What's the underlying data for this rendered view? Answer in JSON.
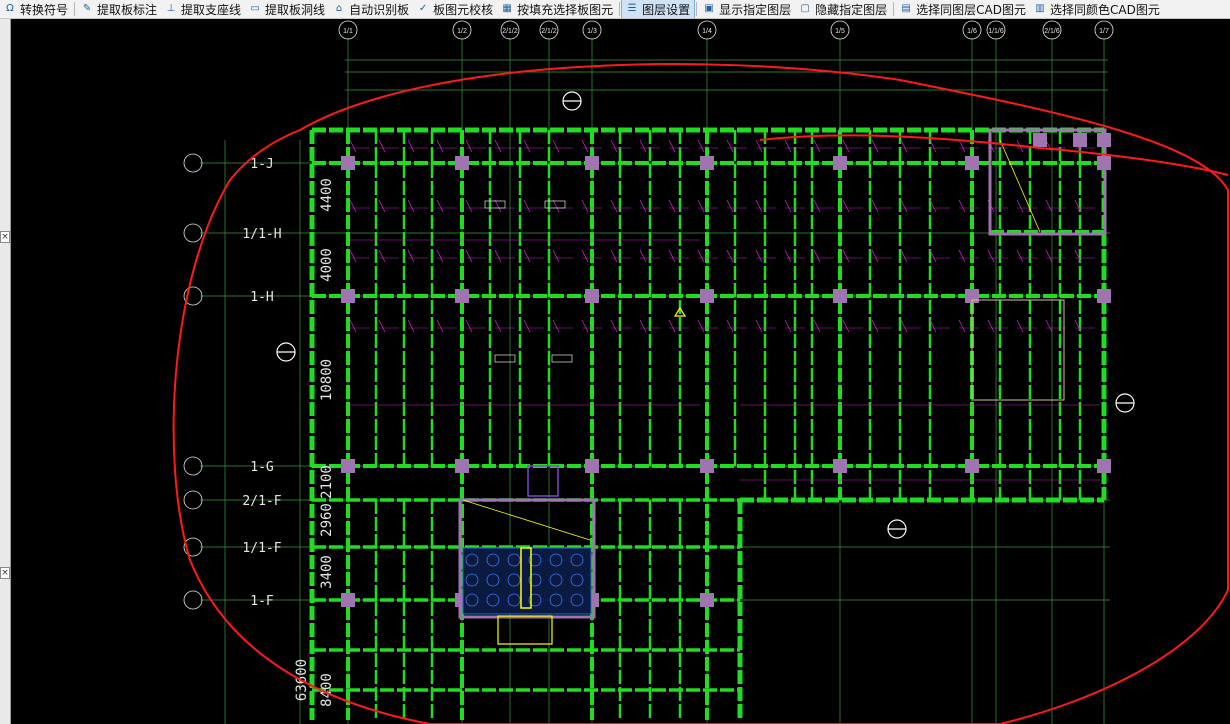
{
  "toolbar": {
    "items": [
      {
        "icon": "symbol-convert-icon",
        "label": "转换符号"
      },
      {
        "icon": "extract-slab-label-icon",
        "label": "提取板标注"
      },
      {
        "icon": "extract-support-line-icon",
        "label": "提取支座线"
      },
      {
        "icon": "extract-slab-hole-icon",
        "label": "提取板洞线"
      },
      {
        "icon": "auto-identify-slab-icon",
        "label": "自动识别板"
      },
      {
        "icon": "slab-element-check-icon",
        "label": "板图元校核"
      },
      {
        "icon": "fill-select-slab-icon",
        "label": "按填充选择板图元"
      },
      {
        "icon": "layer-settings-icon",
        "label": "图层设置"
      },
      {
        "icon": "show-layer-icon",
        "label": "显示指定图层"
      },
      {
        "icon": "hide-layer-icon",
        "label": "隐藏指定图层"
      },
      {
        "icon": "select-same-layer-icon",
        "label": "选择同图层CAD图元"
      },
      {
        "icon": "select-same-color-icon",
        "label": "选择同颜色CAD图元"
      }
    ],
    "active_index": 7
  },
  "drawing": {
    "top_axis_labels": [
      "1/1",
      "1/2",
      "2/1/2",
      "1/3",
      "1/4",
      "1/5",
      "1/6",
      "1/1/6",
      "2/1/6",
      "1/7"
    ],
    "top_axis_x": [
      348,
      462,
      510,
      549,
      592,
      707,
      840,
      972,
      996,
      1052,
      1104
    ],
    "left_axis_labels": [
      "1-J",
      "1/1-H",
      "1-H",
      "1-G",
      "2/1-F",
      "1/1-F",
      "1-F"
    ],
    "vertical_dims": [
      "4400",
      "4000",
      "10800",
      "2100",
      "2960",
      "3400",
      "8400",
      "63600"
    ],
    "colors": {
      "background": "#000000",
      "beam": "#20dd20",
      "column": "#a074b0",
      "axis_line": "#3a9a3a",
      "rebar": "#d020d0",
      "cloud": "#ff1a1a",
      "text": "#e6e6e6",
      "highlight": "#ffff00"
    }
  }
}
